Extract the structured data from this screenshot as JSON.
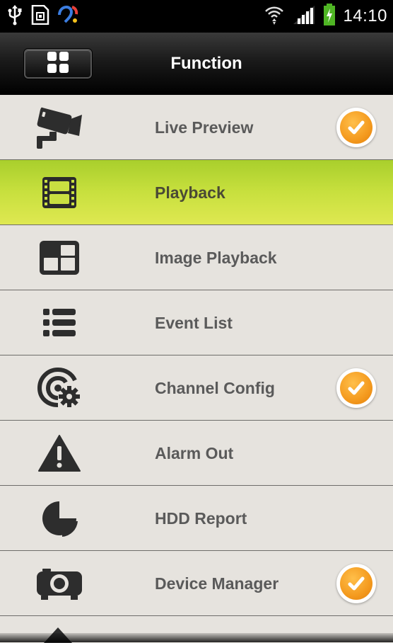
{
  "status_bar": {
    "time": "14:10",
    "icons": [
      "usb-icon",
      "sim-storage-icon",
      "app-notification-icon",
      "wifi-icon",
      "signal-icon",
      "battery-charging-icon"
    ]
  },
  "header": {
    "title": "Function",
    "menu_icon": "grid-menu-icon"
  },
  "accent_colors": {
    "selected_row": "#c8e03e",
    "check_badge": "#f49a1e"
  },
  "menu": {
    "items": [
      {
        "label": "Live Preview",
        "icon": "cctv-camera-icon",
        "checked": true,
        "selected": false
      },
      {
        "label": "Playback",
        "icon": "film-strip-icon",
        "checked": false,
        "selected": true
      },
      {
        "label": "Image Playback",
        "icon": "image-grid-icon",
        "checked": false,
        "selected": false
      },
      {
        "label": "Event List",
        "icon": "list-icon",
        "checked": false,
        "selected": false
      },
      {
        "label": "Channel Config",
        "icon": "channel-config-gear-icon",
        "checked": true,
        "selected": false
      },
      {
        "label": "Alarm Out",
        "icon": "warning-triangle-icon",
        "checked": false,
        "selected": false
      },
      {
        "label": "HDD Report",
        "icon": "pie-chart-icon",
        "checked": false,
        "selected": false
      },
      {
        "label": "Device Manager",
        "icon": "projector-device-icon",
        "checked": true,
        "selected": false
      }
    ]
  }
}
